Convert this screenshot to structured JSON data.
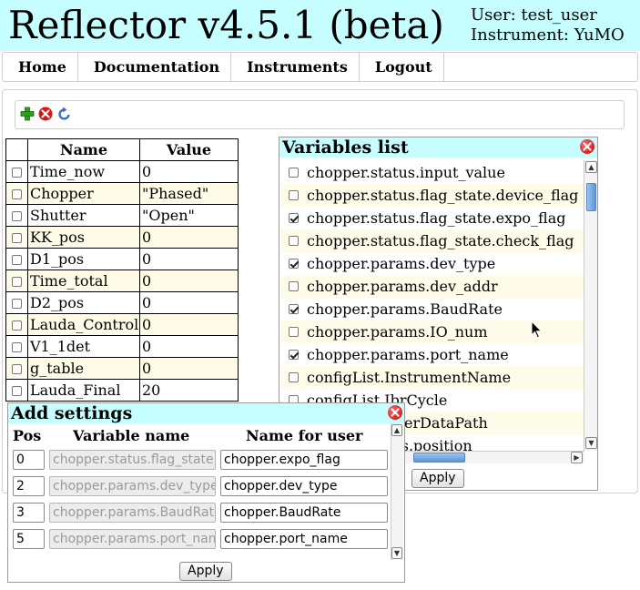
{
  "header": {
    "title": "Reflector v4.5.1 (beta)",
    "user_line": "User: test_user",
    "instrument_line": "Instrument: YuMO"
  },
  "nav": [
    "Home",
    "Documentation",
    "Instruments",
    "Logout"
  ],
  "toolbar": {
    "icons": [
      "add-icon",
      "delete-icon",
      "refresh-icon"
    ],
    "colors": {
      "add": "#2e9e1f",
      "delete": "#d81414",
      "refresh": "#3a6fc9"
    }
  },
  "table": {
    "headers": [
      "Name",
      "Value"
    ],
    "rows": [
      {
        "name": "Time_now",
        "value": "0"
      },
      {
        "name": "Chopper",
        "value": "\"Phased\""
      },
      {
        "name": "Shutter",
        "value": "\"Open\""
      },
      {
        "name": "KK_pos",
        "value": "0"
      },
      {
        "name": "D1_pos",
        "value": "0"
      },
      {
        "name": "Time_total",
        "value": "0"
      },
      {
        "name": "D2_pos",
        "value": "0"
      },
      {
        "name": "Lauda_Control",
        "value": "0"
      },
      {
        "name": "V1_1det",
        "value": "0"
      },
      {
        "name": "g_table",
        "value": "0"
      },
      {
        "name": "Lauda_Final",
        "value": "20"
      }
    ]
  },
  "variables_popup": {
    "title": "Variables list",
    "apply_label": "Apply",
    "items": [
      {
        "label": "chopper.status.input_value",
        "checked": false
      },
      {
        "label": "chopper.status.flag_state.device_flag",
        "checked": false
      },
      {
        "label": "chopper.status.flag_state.expo_flag",
        "checked": true
      },
      {
        "label": "chopper.status.flag_state.check_flag",
        "checked": false
      },
      {
        "label": "chopper.params.dev_type",
        "checked": true
      },
      {
        "label": "chopper.params.dev_addr",
        "checked": false
      },
      {
        "label": "chopper.params.BaudRate",
        "checked": true
      },
      {
        "label": "chopper.params.IO_num",
        "checked": false
      },
      {
        "label": "chopper.params.port_name",
        "checked": true
      },
      {
        "label": "configList.InstrumentName",
        "checked": false
      },
      {
        "label": "configList.IbrCycle",
        "checked": false
      },
      {
        "label": "configList.UserDataPath",
        "checked": false
      },
      {
        "label": "sample.status.position",
        "checked": false
      }
    ]
  },
  "add_popup": {
    "title": "Add settings",
    "headers": {
      "pos": "Pos",
      "var": "Variable name",
      "user": "Name for user"
    },
    "apply_label": "Apply",
    "rows": [
      {
        "pos": "0",
        "var": "chopper.status.flag_state.expo_flag",
        "user": "chopper.expo_flag"
      },
      {
        "pos": "2",
        "var": "chopper.params.dev_type",
        "user": "chopper.dev_type"
      },
      {
        "pos": "3",
        "var": "chopper.params.BaudRate",
        "user": "chopper.BaudRate"
      },
      {
        "pos": "5",
        "var": "chopper.params.port_name",
        "user": "chopper.port_name"
      }
    ]
  }
}
